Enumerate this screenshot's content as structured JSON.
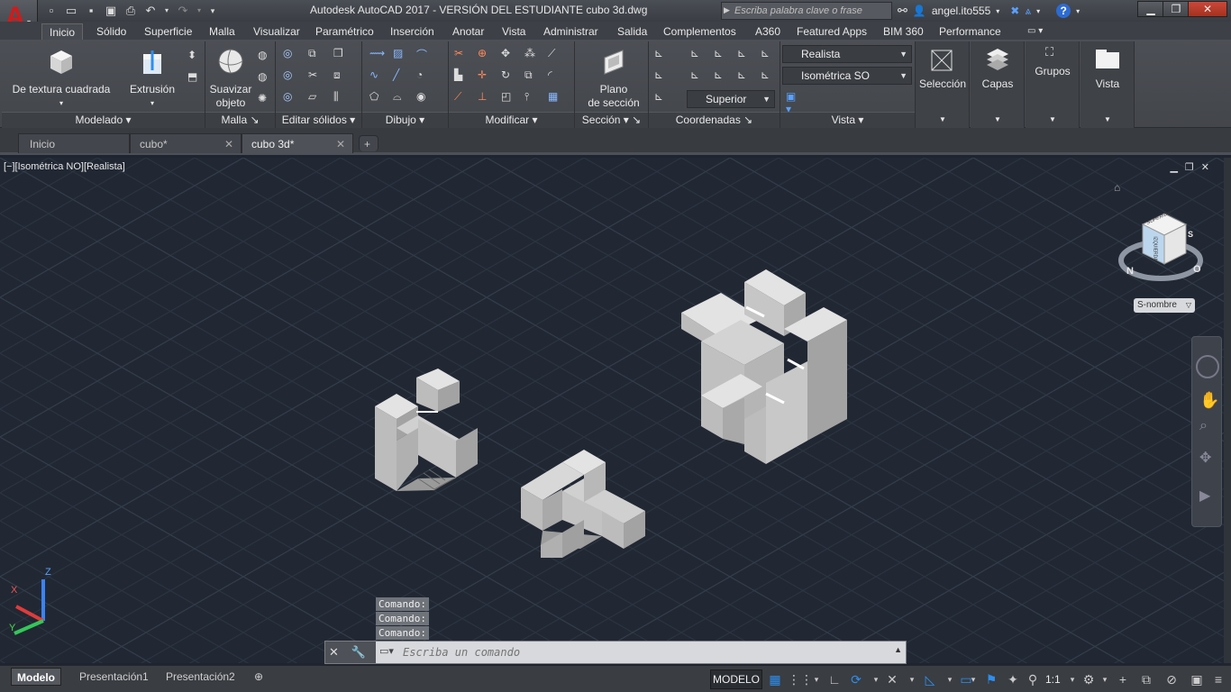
{
  "titlebar": {
    "app_letter": "A",
    "title": "Autodesk AutoCAD 2017 - VERSIÓN DEL ESTUDIANTE    cubo 3d.dwg",
    "search_placeholder": "Escriba palabra clave o frase",
    "user": "angel.ito555",
    "help": "?"
  },
  "ribbon_tabs": [
    "Inicio",
    "Sólido",
    "Superficie",
    "Malla",
    "Visualizar",
    "Paramétrico",
    "Inserción",
    "Anotar",
    "Vista",
    "Administrar",
    "Salida",
    "Complementos",
    "A360",
    "Featured Apps",
    "BIM 360",
    "Performance"
  ],
  "ribbon": {
    "modelado": {
      "label": "Modelado",
      "btn1": "De textura cuadrada",
      "btn2": "Extrusión"
    },
    "malla": {
      "label": "Malla",
      "btn1a": "Suavizar",
      "btn1b": "objeto"
    },
    "editar": {
      "label": "Editar sólidos"
    },
    "dibujo": {
      "label": "Dibujo"
    },
    "modificar": {
      "label": "Modificar"
    },
    "seccion": {
      "label": "Sección",
      "btn1a": "Plano",
      "btn1b": "de sección"
    },
    "coordenadas": {
      "label": "Coordenadas",
      "dropdown": "Superior"
    },
    "vista": {
      "label": "Vista",
      "style": "Realista",
      "view": "Isométrica SO"
    },
    "seleccion": "Selección",
    "capas": "Capas",
    "grupos": "Grupos",
    "vista_btn": "Vista"
  },
  "file_tabs": [
    {
      "label": "Inicio"
    },
    {
      "label": "cubo*"
    },
    {
      "label": "cubo 3d*"
    }
  ],
  "viewport": {
    "label": "[−][Isométrica NO][Realista]",
    "viewcube_face": "SUPERIOR",
    "viewcube_side": "IZQUIERDA",
    "compass_n": "N",
    "compass_o": "O",
    "compass_s": "S",
    "ucs_dropdown": "S-nombre",
    "axis_z": "Z",
    "axis_x": "X",
    "axis_y": "Y"
  },
  "command": {
    "history": [
      "Comando:",
      "Comando:",
      "Comando:"
    ],
    "placeholder": "Escriba un comando"
  },
  "status": {
    "layout_tabs": [
      "Modelo",
      "Presentación1",
      "Presentación2"
    ],
    "model_button": "MODELO",
    "scale": "1:1"
  },
  "colors": {
    "viewport_bg": "#212833",
    "ribbon_bg": "#474a50",
    "accent_blue": "#2d8ff0",
    "solid_light": "#c9c9c9",
    "solid_mid": "#a6a6a6",
    "solid_dark": "#8d8d8d"
  }
}
